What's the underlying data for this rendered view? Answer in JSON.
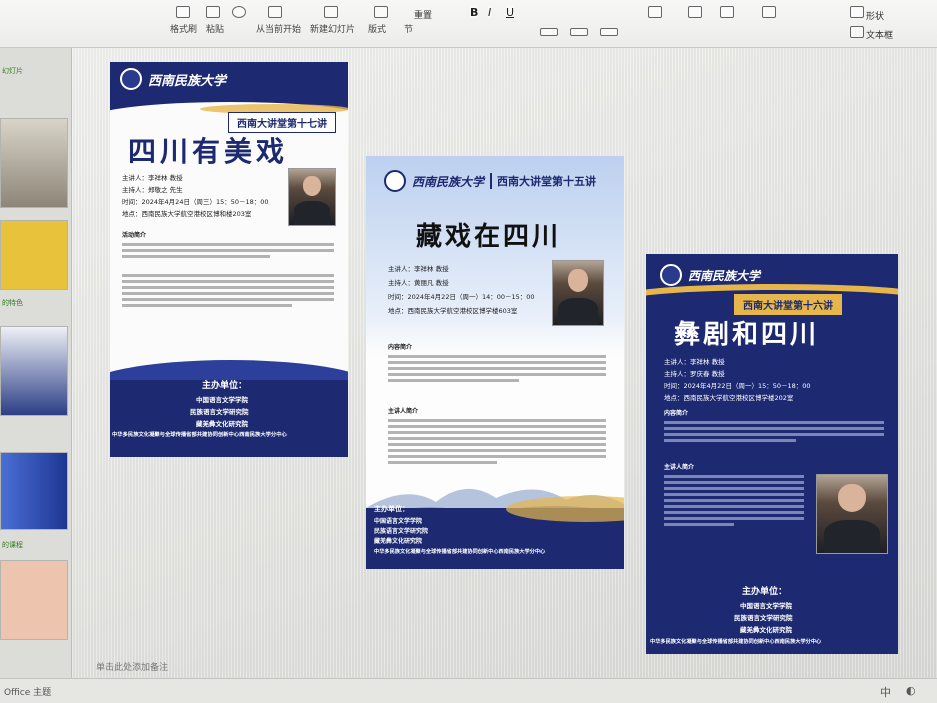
{
  "toolbar": {
    "items": [
      "格式刷",
      "粘贴",
      "从当前开始",
      "新建幻灯片",
      "版式",
      "节"
    ],
    "reset_label": "重置",
    "shape_label": "形状",
    "textbox_label": "文本框"
  },
  "sidebar": {
    "labels": [
      "幻灯片",
      "的特色",
      "的课程"
    ]
  },
  "notes_placeholder": "单击此处添加备注",
  "status": {
    "office_label": "Office 主题",
    "ime_label": "中"
  },
  "poster1": {
    "badge": "西南大讲堂第十七讲",
    "title": "四川有美戏",
    "speaker": "主讲人：李祥林 教授",
    "host": "主持人：郑敬之 先生",
    "time": "时间：2024年4月24日（周三）15：50－18：00",
    "place": "地点：西南民族大学航空港校区博和楼203室",
    "intro_heading": "活动简介",
    "sponsor_heading": "主办单位：",
    "sponsors": [
      "中国语言文学学院",
      "民族语言文学研究院",
      "藏羌彝文化研究院",
      "中华多民族文化凝聚与全球传播省部共建协同创新中心西南民族大学分中心"
    ]
  },
  "poster2": {
    "school": "西南民族大学",
    "badge": "西南大讲堂第十五讲",
    "title": "藏戏在四川",
    "speaker": "主讲人：李祥林 教授",
    "host": "主持人：黄丽凡 教授",
    "time": "时间：2024年4月22日（周一）14：00－15：00",
    "place": "地点：西南民族大学航空港校区博学楼603室",
    "intro_heading": "内容简介",
    "bio_heading": "主讲人简介",
    "sponsor_heading": "主办单位：",
    "sponsors": [
      "中国语言文学学院",
      "民族语言文学研究院",
      "藏羌彝文化研究院",
      "中华多民族文化凝聚与全球传播省部共建协同创新中心西南民族大学分中心"
    ]
  },
  "poster3": {
    "school": "西南民族大学",
    "badge": "西南大讲堂第十六讲",
    "title": "彝剧和四川",
    "speaker": "主讲人：李祥林 教授",
    "host": "主持人：罗庆春 教授",
    "time": "时间：2024年4月22日（周一）15：50－18：00",
    "place": "地点：西南民族大学航空港校区博学楼202室",
    "intro_heading": "内容简介",
    "bio_heading": "主讲人简介",
    "sponsor_heading": "主办单位：",
    "sponsors": [
      "中国语言文学学院",
      "民族语言文学研究院",
      "藏羌彝文化研究院",
      "中华多民族文化凝聚与全球传播省部共建协同创新中心西南民族大学分中心"
    ]
  },
  "colors": {
    "navy": "#1d2a72",
    "gold": "#e7b64a",
    "light_blue": "#bcd0ef"
  }
}
